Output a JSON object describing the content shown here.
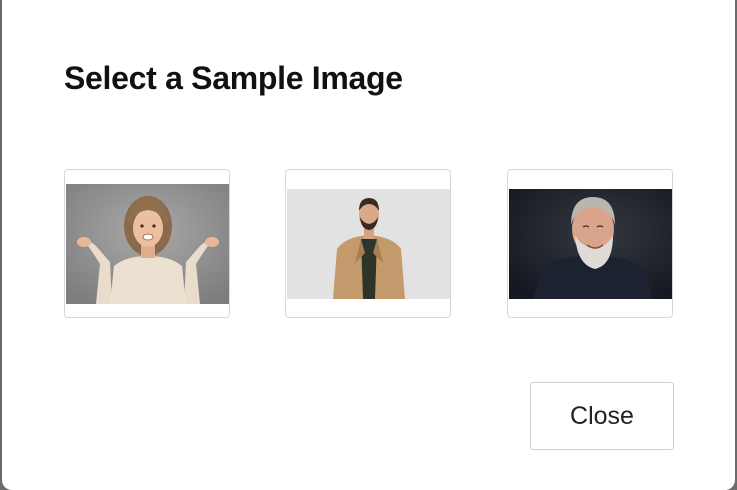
{
  "dialog": {
    "title": "Select a Sample Image",
    "close_label": "Close"
  },
  "samples": [
    {
      "name": "woman-excited-photo"
    },
    {
      "name": "man-tan-coat-photo"
    },
    {
      "name": "older-man-beard-photo"
    }
  ]
}
